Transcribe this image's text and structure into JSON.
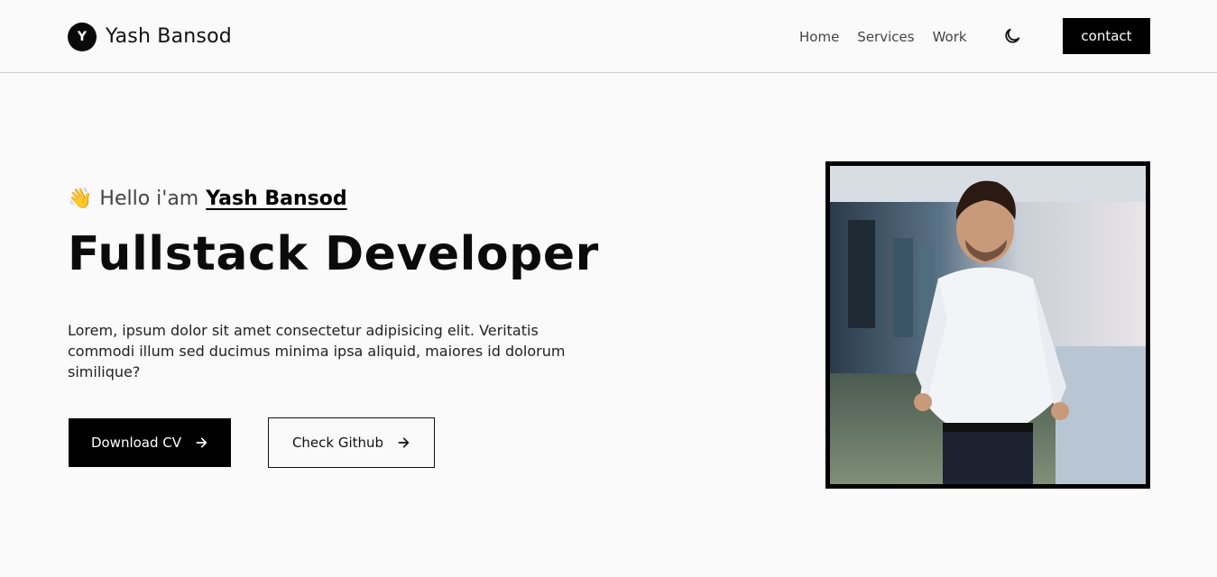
{
  "header": {
    "logo_letter": "Y",
    "brand": "Yash Bansod",
    "nav": [
      "Home",
      "Services",
      "Work"
    ],
    "theme_icon": "moon-icon",
    "contact_label": "contact"
  },
  "hero": {
    "wave_emoji": "👋",
    "greeting": "Hello i'am",
    "name": "Yash Bansod",
    "role": "Fullstack Developer",
    "intro": "Lorem, ipsum dolor sit amet consectetur adipisicing elit. Veritatis commodi illum sed ducimus minima ipsa aliquid, maiores id dolorum similique?",
    "primary_button": "Download CV",
    "secondary_button": "Check Github",
    "arrow_icon": "arrow-right-icon"
  },
  "profile": {
    "photo_icon": "profile-photo"
  },
  "colors": {
    "background": "#fafafa",
    "accent": "#000000",
    "text": "#111111"
  }
}
